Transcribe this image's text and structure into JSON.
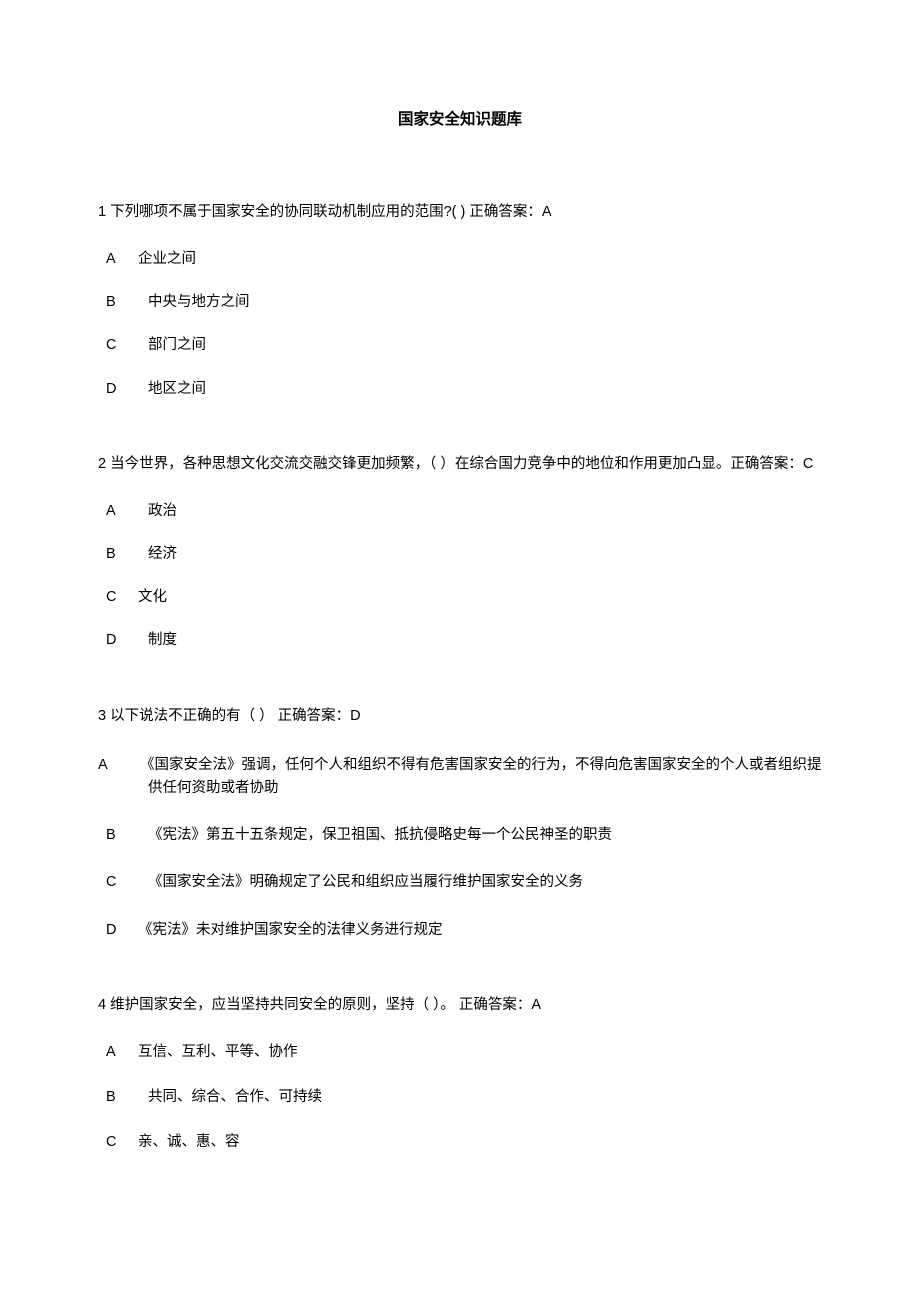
{
  "title": "国家安全知识题库",
  "questions": [
    {
      "num": "1",
      "text": "下列哪项不属于国家安全的协同联动机制应用的范围?( )  正确答案：A",
      "options": [
        {
          "letter": "A",
          "text": "企业之间"
        },
        {
          "letter": "B",
          "text": "中央与地方之间"
        },
        {
          "letter": "C",
          "text": "部门之间"
        },
        {
          "letter": "D",
          "text": "地区之间"
        }
      ]
    },
    {
      "num": "2",
      "text": "当今世界，各种思想文化交流交融交锋更加频繁，（ ）在综合国力竞争中的地位和作用更加凸显。正确答案：C",
      "options": [
        {
          "letter": "A",
          "text": "政治"
        },
        {
          "letter": "B",
          "text": "经济"
        },
        {
          "letter": "C",
          "text": "文化"
        },
        {
          "letter": "D",
          "text": "制度"
        }
      ]
    },
    {
      "num": "3",
      "text": "以下说法不正确的有（ ）  正确答案：D",
      "options": [
        {
          "letter": "A",
          "text": "《国家安全法》强调，任何个人和组织不得有危害国家安全的行为，不得向危害国家安全的个人或者组织提供任何资助或者协助"
        },
        {
          "letter": "B",
          "text": "《宪法》第五十五条规定，保卫祖国、抵抗侵略史每一个公民神圣的职责"
        },
        {
          "letter": "C",
          "text": "《国家安全法》明确规定了公民和组织应当履行维护国家安全的义务"
        },
        {
          "letter": "D",
          "text": "《宪法》未对维护国家安全的法律义务进行规定"
        }
      ]
    },
    {
      "num": "4",
      "text": "维护国家安全，应当坚持共同安全的原则，坚持（ ）。  正确答案：A",
      "options": [
        {
          "letter": "A",
          "text": "互信、互利、平等、协作"
        },
        {
          "letter": "B",
          "text": "共同、综合、合作、可持续"
        },
        {
          "letter": "C",
          "text": "亲、诚、惠、容"
        }
      ]
    }
  ]
}
